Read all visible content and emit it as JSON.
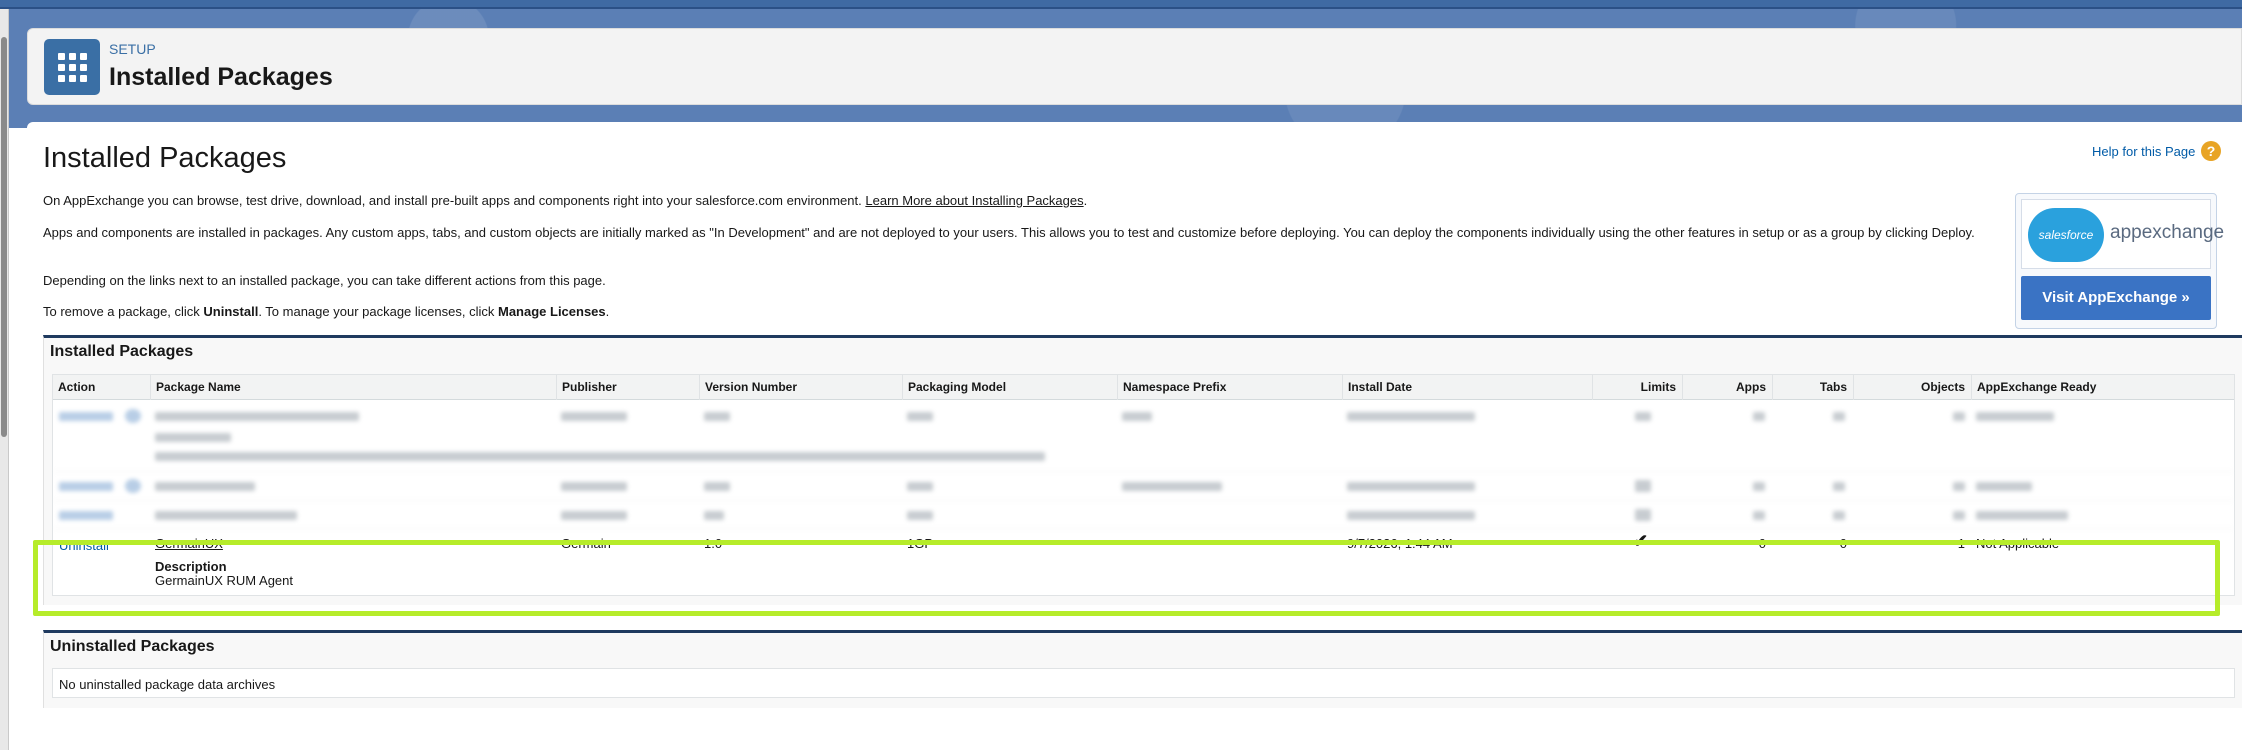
{
  "header": {
    "breadcrumb": "SETUP",
    "title": "Installed Packages"
  },
  "page": {
    "title": "Installed Packages",
    "help_link": "Help for this Page",
    "intro": {
      "p1_text": "On AppExchange you can browse, test drive, download, and install pre-built apps and components right into your salesforce.com environment.",
      "p1_link": "Learn More about Installing Packages",
      "p2": "Apps and components are installed in packages. Any custom apps, tabs, and custom objects are initially marked as \"In Development\" and are not deployed to your users. This allows you to test and customize before deploying. You can deploy the components individually using the other features in setup or as a group by clicking Deploy.",
      "p3": "Depending on the links next to an installed package, you can take different actions from this page.",
      "p4_a": "To remove a package, click ",
      "p4_b": "Uninstall",
      "p4_c": ". To manage your package licenses, click ",
      "p4_d": "Manage Licenses",
      "p4_e": "."
    }
  },
  "appexchange": {
    "logo_brand": "salesforce",
    "logo_word": "appexchange",
    "button": "Visit AppExchange »"
  },
  "installed": {
    "section_title": "Installed Packages",
    "columns": [
      "Action",
      "Package Name",
      "Publisher",
      "Version Number",
      "Packaging Model",
      "Namespace Prefix",
      "Install Date",
      "Limits",
      "Apps",
      "Tabs",
      "Objects",
      "AppExchange Ready"
    ],
    "highlighted_row": {
      "action": "Uninstall",
      "package_name": "GermainUX",
      "publisher": "Germain",
      "version": "1.0",
      "packaging_model": "1GP",
      "namespace_prefix": "",
      "install_date": "9/7/2026, 1:44 AM",
      "limits": "✔",
      "apps": "0",
      "tabs": "0",
      "objects": "1",
      "appexchange_ready": "Not Applicable",
      "description_label": "Description",
      "description": "GermainUX RUM Agent"
    },
    "accent_color": "#b6ec2a"
  },
  "uninstalled": {
    "section_title": "Uninstalled Packages",
    "empty_message": "No uninstalled package data archives"
  }
}
